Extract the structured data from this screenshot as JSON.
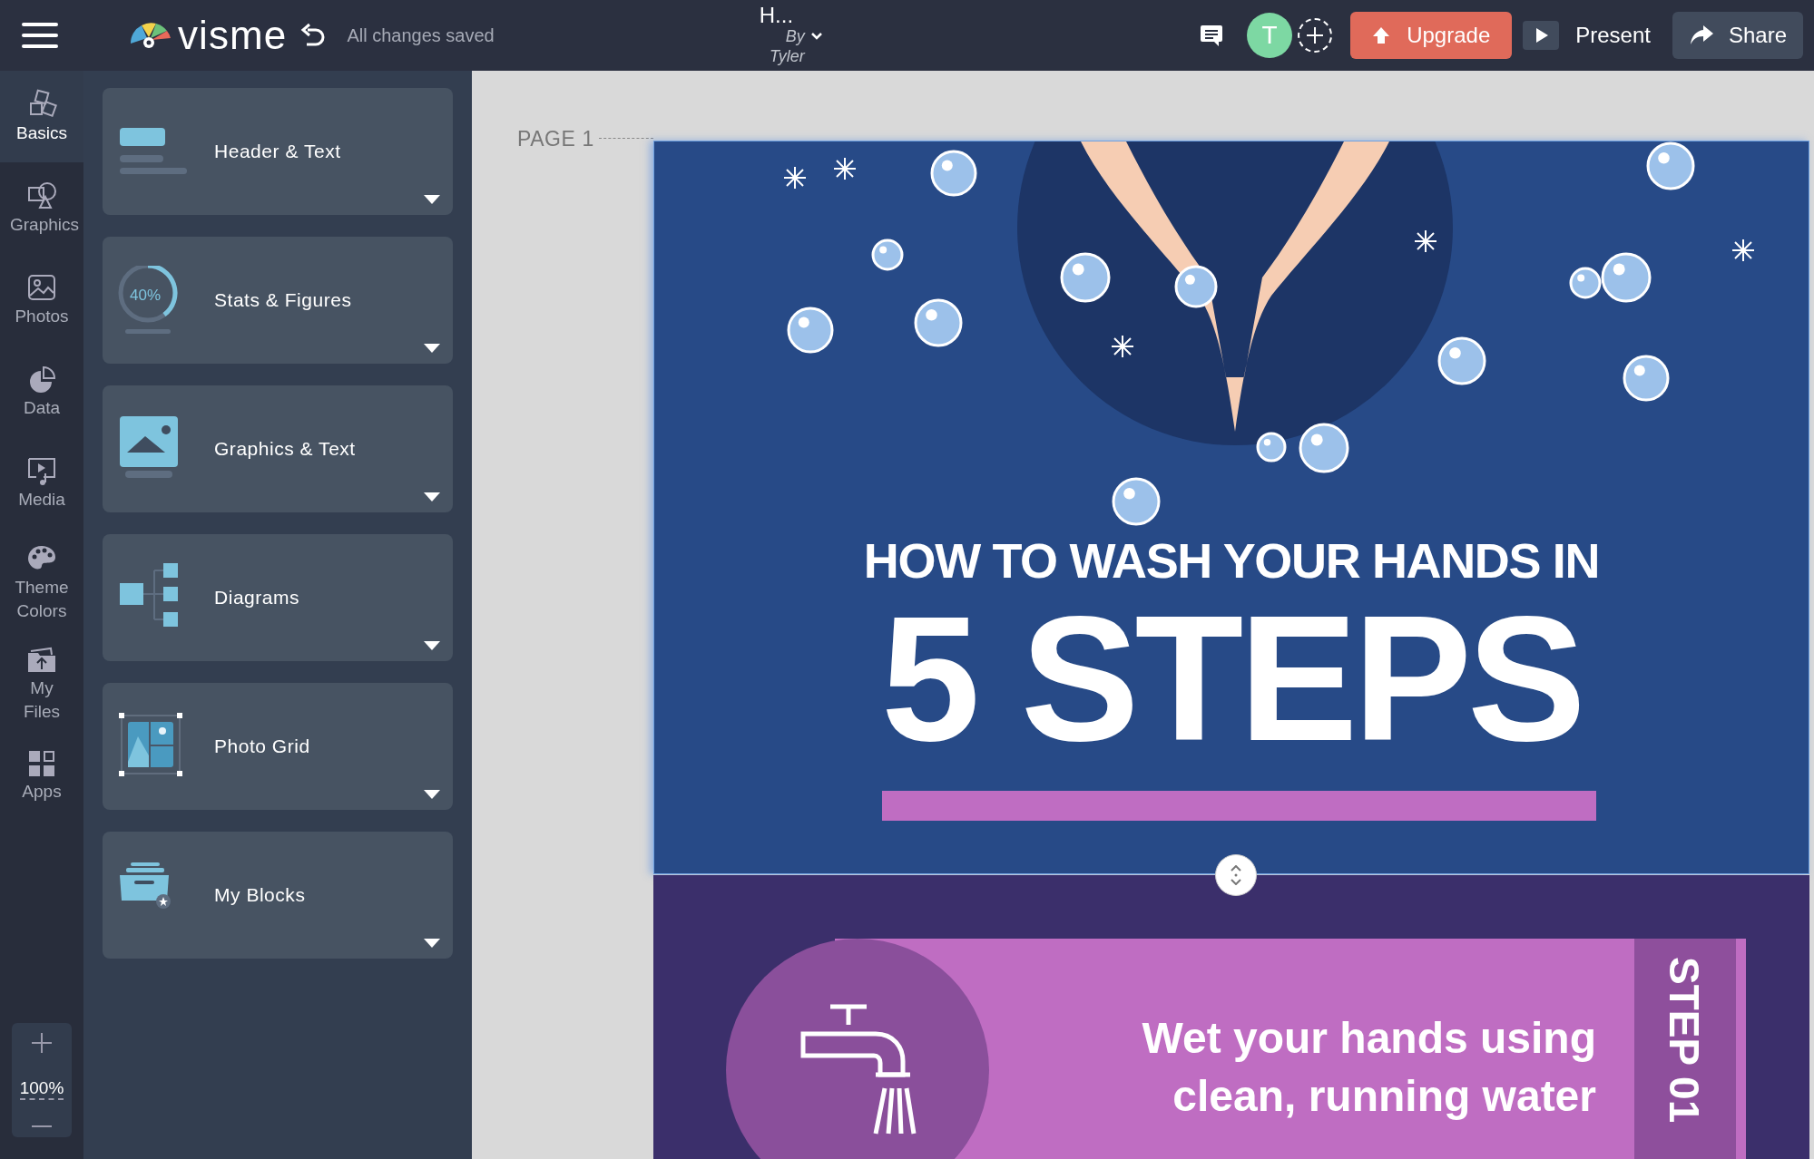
{
  "top_bar": {
    "logo": "visme",
    "save_status": "All changes saved",
    "project_title": "H...",
    "author": "By Tyler",
    "avatar_initial": "T",
    "buttons": [
      {
        "kind": "upgrade",
        "label": "Upgrade"
      },
      {
        "kind": "present",
        "label": "Present"
      },
      {
        "kind": "share",
        "label": "Share"
      }
    ]
  },
  "rail": {
    "items": [
      {
        "label": "Basics",
        "selected": true
      },
      {
        "label": "Graphics",
        "selected": false
      },
      {
        "label": "Photos",
        "selected": false
      },
      {
        "label": "Data",
        "selected": false
      },
      {
        "label": "Media",
        "selected": false
      },
      {
        "label": "Theme Colors",
        "selected": false
      },
      {
        "label": "My Files",
        "selected": false
      },
      {
        "label": "Apps",
        "selected": false
      }
    ],
    "zoom": "100%"
  },
  "panel": {
    "cards": [
      {
        "label": "Header & Text"
      },
      {
        "label": "Stats & Figures",
        "icon_text": "40%"
      },
      {
        "label": "Graphics & Text"
      },
      {
        "label": "Diagrams"
      },
      {
        "label": "Photo Grid"
      },
      {
        "label": "My Blocks"
      }
    ]
  },
  "canvas": {
    "page_label": "PAGE 1",
    "title_line": "HOW TO WASH YOUR HANDS IN",
    "title_big": "5 STEPS",
    "step_text": "Wet your hands using clean, running water",
    "step_label": "STEP 01"
  }
}
